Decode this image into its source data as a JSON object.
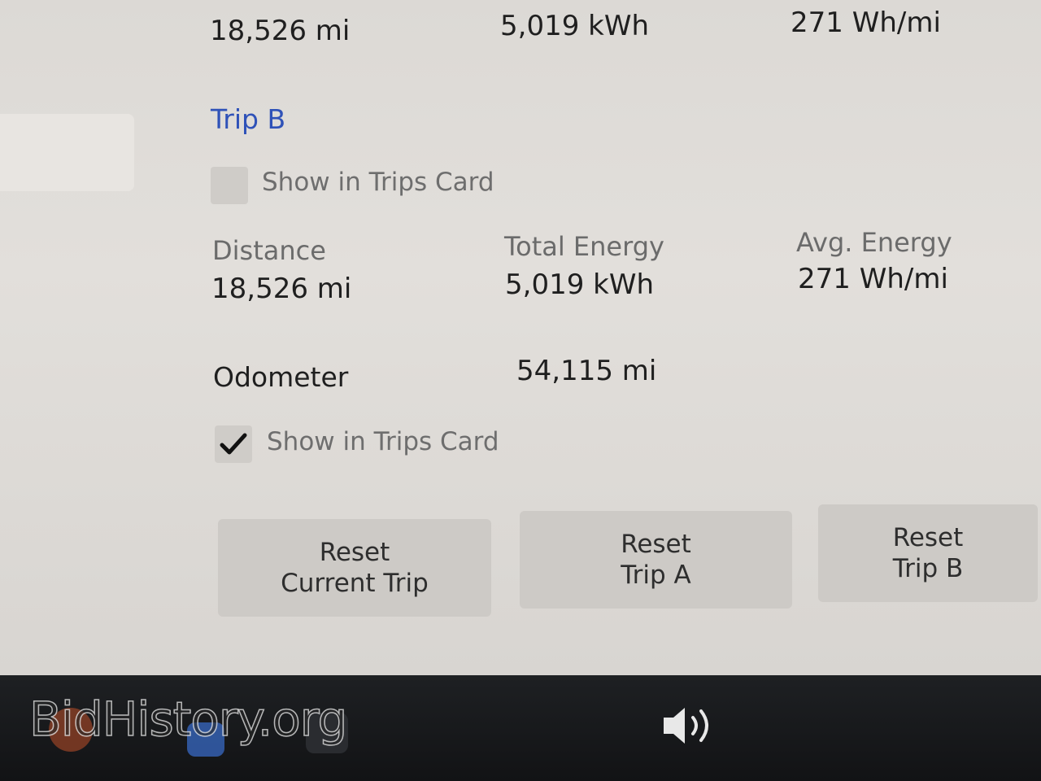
{
  "trip_a_values": {
    "distance": "18,526 mi",
    "total_energy": "5,019 kWh",
    "avg_energy": "271 Wh/mi"
  },
  "trip_b": {
    "title": "Trip B",
    "show_in_trips_card_label": "Show in Trips Card",
    "show_in_trips_card_checked": false,
    "distance_label": "Distance",
    "distance_value": "18,526 mi",
    "total_energy_label": "Total Energy",
    "total_energy_value": "5,019 kWh",
    "avg_energy_label": "Avg. Energy",
    "avg_energy_value": "271 Wh/mi"
  },
  "odometer": {
    "label": "Odometer",
    "value": "54,115 mi",
    "show_in_trips_card_label": "Show in Trips Card",
    "show_in_trips_card_checked": true
  },
  "buttons": {
    "reset_current_line1": "Reset",
    "reset_current_line2": "Current Trip",
    "reset_a_line1": "Reset",
    "reset_a_line2": "Trip A",
    "reset_b_line1": "Reset",
    "reset_b_line2": "Trip B"
  },
  "watermark": "BidHistory.org",
  "icons": {
    "volume": "volume-icon",
    "checkmark": "checkmark-icon"
  },
  "colors": {
    "accent": "#2f52b8",
    "screen_bg": "#dcd9d5",
    "button_bg": "#cdcac6",
    "bottom_bar": "#16181a"
  }
}
